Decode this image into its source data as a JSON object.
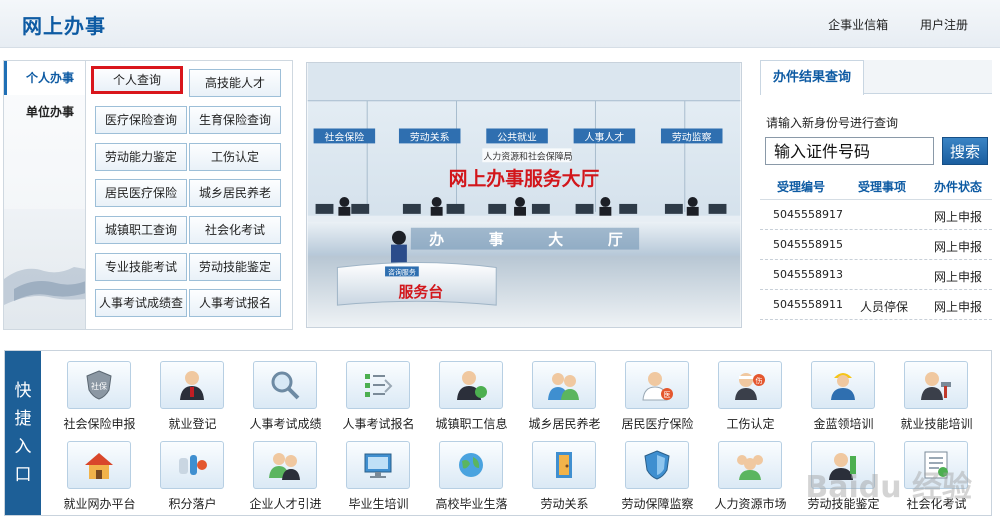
{
  "header": {
    "title": "网上办事",
    "link_enterprise": "企事业信箱",
    "link_register": "用户注册"
  },
  "left_tabs": [
    {
      "label": "个人办事",
      "active": true
    },
    {
      "label": "单位办事",
      "active": false
    }
  ],
  "links": [
    {
      "label": "个人查询",
      "highlighted": true
    },
    {
      "label": "高技能人才"
    },
    {
      "label": "医疗保险查询"
    },
    {
      "label": "生育保险查询"
    },
    {
      "label": "劳动能力鉴定"
    },
    {
      "label": "工伤认定"
    },
    {
      "label": "居民医疗保险"
    },
    {
      "label": "城乡居民养老"
    },
    {
      "label": "城镇职工查询"
    },
    {
      "label": "社会化考试"
    },
    {
      "label": "专业技能考试"
    },
    {
      "label": "劳动技能鉴定"
    },
    {
      "label": "人事考试成绩查"
    },
    {
      "label": "人事考试报名"
    }
  ],
  "hall": {
    "signs": [
      "社会保险",
      "劳动关系",
      "公共就业",
      "人事人才",
      "劳动监察"
    ],
    "org_name": "人力资源和社会保障局",
    "big_title": "网上办事服务大厅",
    "counter_chars": [
      "办",
      "事",
      "大",
      "厅"
    ],
    "desk_plate": "咨询服务",
    "desk_text": "服务台"
  },
  "result": {
    "tab_label": "办件结果查询",
    "hint": "请输入新身份号进行查询",
    "input_placeholder": "输入证件号码",
    "search_label": "搜索",
    "headers": [
      "受理编号",
      "受理事项",
      "办件状态"
    ],
    "rows": [
      {
        "id": "5045558917",
        "item": "",
        "status": "网上申报"
      },
      {
        "id": "5045558915",
        "item": "",
        "status": "网上申报"
      },
      {
        "id": "5045558913",
        "item": "",
        "status": "网上申报"
      },
      {
        "id": "5045558911",
        "item": "人员停保",
        "status": "网上申报"
      }
    ]
  },
  "quick": {
    "label_chars": [
      "快",
      "捷",
      "入",
      "口"
    ],
    "items": [
      {
        "label": "社会保险申报",
        "icon": "shield-icon"
      },
      {
        "label": "就业登记",
        "icon": "person-icon"
      },
      {
        "label": "人事考试成绩",
        "icon": "magnifier-icon"
      },
      {
        "label": "人事考试报名",
        "icon": "checklist-icon"
      },
      {
        "label": "城镇职工信息",
        "icon": "worker-icon"
      },
      {
        "label": "城乡居民养老",
        "icon": "people-icon"
      },
      {
        "label": "居民医疗保险",
        "icon": "doctor-icon"
      },
      {
        "label": "工伤认定",
        "icon": "injury-icon"
      },
      {
        "label": "金蓝领培训",
        "icon": "helmet-worker-icon"
      },
      {
        "label": "就业技能培训",
        "icon": "tools-icon"
      },
      {
        "label": "就业网办平台",
        "icon": "house-icon"
      },
      {
        "label": "积分落户",
        "icon": "points-icon"
      },
      {
        "label": "企业人才引进",
        "icon": "talent-icon"
      },
      {
        "label": "毕业生培训",
        "icon": "monitor-icon"
      },
      {
        "label": "高校毕业生落",
        "icon": "globe-icon"
      },
      {
        "label": "劳动关系",
        "icon": "door-icon"
      },
      {
        "label": "劳动保障监察",
        "icon": "shield-blue-icon"
      },
      {
        "label": "人力资源市场",
        "icon": "group-icon"
      },
      {
        "label": "劳动技能鉴定",
        "icon": "skill-icon"
      },
      {
        "label": "社会化考试",
        "icon": "exam-icon"
      }
    ]
  },
  "watermark": "Baidu 经验"
}
